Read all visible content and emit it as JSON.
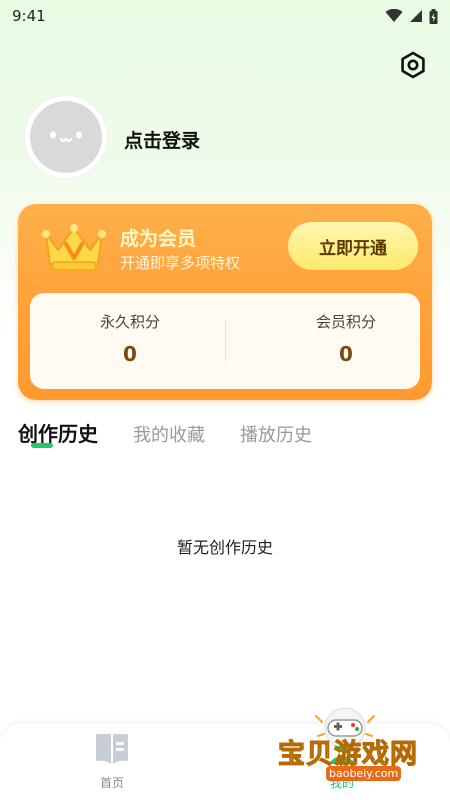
{
  "status_bar": {
    "time": "9:41"
  },
  "profile": {
    "login_text": "点击登录"
  },
  "vip": {
    "title": "成为会员",
    "subtitle": "开通即享多项特权",
    "button_label": "立即开通",
    "points": [
      {
        "label": "永久积分",
        "value": "0"
      },
      {
        "label": "会员积分",
        "value": "0"
      }
    ]
  },
  "tabs": [
    {
      "label": "创作历史",
      "active": true
    },
    {
      "label": "我的收藏",
      "active": false
    },
    {
      "label": "播放历史",
      "active": false
    }
  ],
  "empty_state": {
    "text": "暂无创作历史"
  },
  "bottom_nav": [
    {
      "label": "首页",
      "icon": "book-icon",
      "active": false
    },
    {
      "label": "我的",
      "icon": "profile-icon",
      "active": true
    }
  ],
  "watermark": {
    "text": "宝贝游戏网",
    "url": "baobeiy.com"
  },
  "colors": {
    "accent_green": "#29c46e",
    "vip_orange": "#ffa23a",
    "vip_button_yellow": "#ffe96d"
  }
}
